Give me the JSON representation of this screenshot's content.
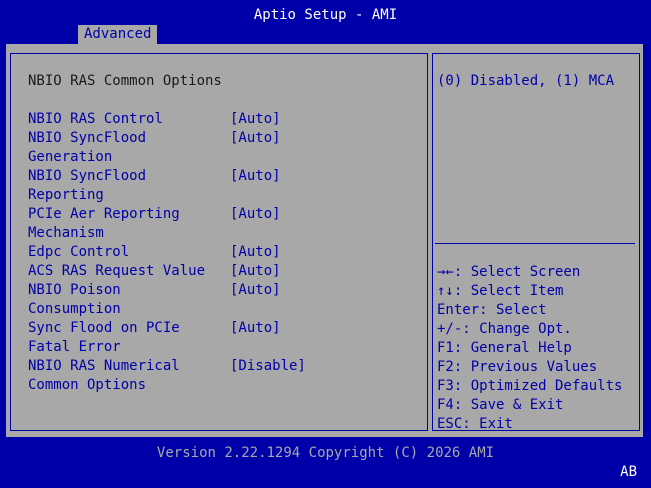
{
  "header": {
    "title": "Aptio Setup - AMI",
    "active_tab": "Advanced"
  },
  "main": {
    "section_title": "NBIO RAS Common Options",
    "settings": [
      {
        "label": "NBIO RAS Control",
        "label2": "",
        "value": "[Auto]"
      },
      {
        "label": "NBIO SyncFlood",
        "label2": "Generation",
        "value": "[Auto]"
      },
      {
        "label": "NBIO SyncFlood",
        "label2": "Reporting",
        "value": "[Auto]"
      },
      {
        "label": "PCIe Aer Reporting",
        "label2": "Mechanism",
        "value": "[Auto]"
      },
      {
        "label": "Edpc Control",
        "label2": "",
        "value": "[Auto]"
      },
      {
        "label": "ACS RAS Request Value",
        "label2": "",
        "value": "[Auto]"
      },
      {
        "label": "NBIO Poison",
        "label2": "Consumption",
        "value": "[Auto]"
      },
      {
        "label": "Sync Flood on PCIe",
        "label2": "Fatal Error",
        "value": "[Auto]"
      },
      {
        "label": "NBIO RAS Numerical",
        "label2": "Common Options",
        "value": "[Disable]"
      }
    ]
  },
  "help": {
    "description": "(0) Disabled, (1) MCA",
    "keys": [
      "→←: Select Screen",
      "↑↓: Select Item",
      "Enter: Select",
      "+/-: Change Opt.",
      "F1: General Help",
      "F2: Previous Values",
      "F3: Optimized Defaults",
      "F4: Save & Exit",
      "ESC: Exit"
    ]
  },
  "footer": {
    "version": "Version 2.22.1294 Copyright (C) 2026 AMI",
    "corner": "AB"
  },
  "colors": {
    "background": "#0000a8",
    "panel": "#a8a8a8",
    "text_highlight": "#ffffff",
    "text_normal": "#0000a8"
  }
}
